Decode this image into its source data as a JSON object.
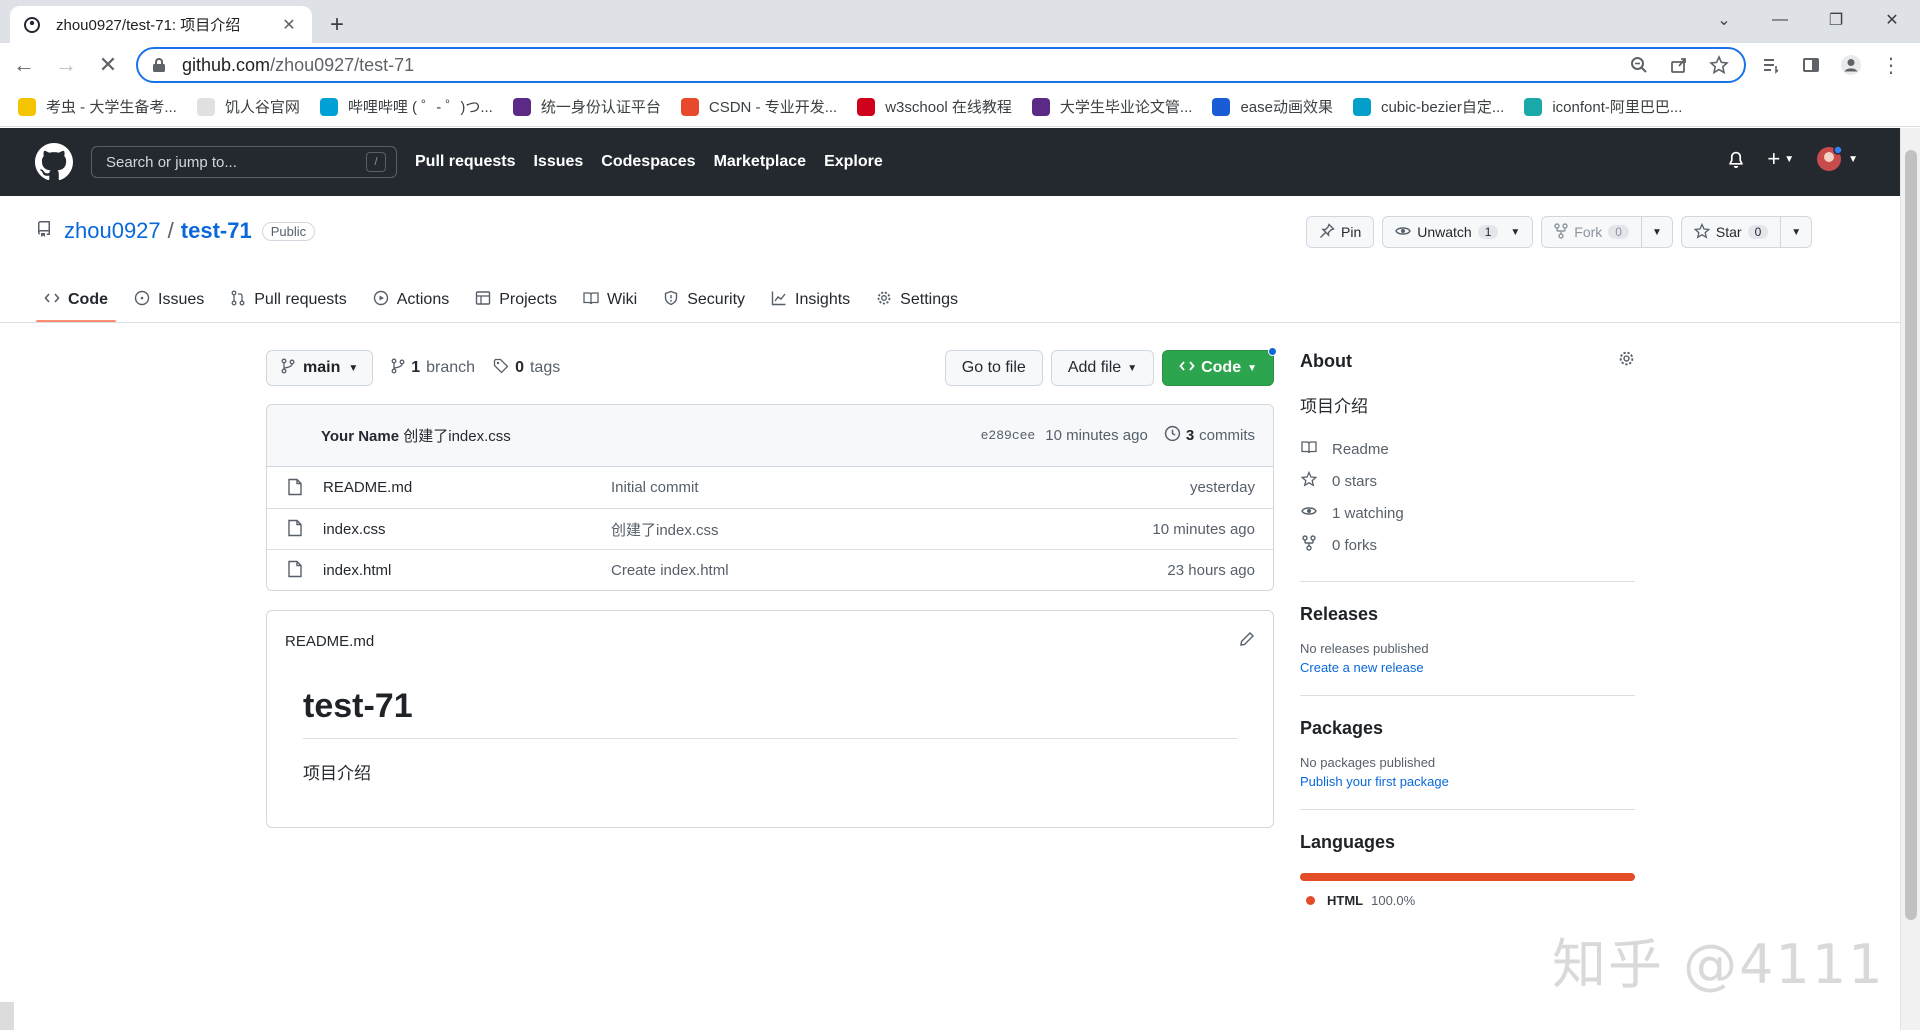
{
  "browser": {
    "tab_title": "zhou0927/test-71: 项目介绍",
    "url_host": "github.com",
    "url_path": "/zhou0927/test-71",
    "bookmarks": [
      {
        "label": "考虫 - 大学生备考...",
        "color": "#f5c400"
      },
      {
        "label": "饥人谷官网",
        "color": "#e0e0e0"
      },
      {
        "label": "哔哩哔哩 ( ゜- ゜)つ...",
        "color": "#00a1d6"
      },
      {
        "label": "统一身份认证平台",
        "color": "#5b2a86"
      },
      {
        "label": "CSDN - 专业开发...",
        "color": "#e8482c"
      },
      {
        "label": "w3school 在线教程",
        "color": "#d0021b"
      },
      {
        "label": "大学生毕业论文管...",
        "color": "#5b2a86"
      },
      {
        "label": "ease动画效果",
        "color": "#1a5bd6"
      },
      {
        "label": "cubic-bezier自定...",
        "color": "#00a0c8"
      },
      {
        "label": "iconfont-阿里巴巴...",
        "color": "#19a9a9"
      }
    ]
  },
  "gh": {
    "search_placeholder": "Search or jump to...",
    "search_hotkey": "/",
    "nav": [
      "Pull requests",
      "Issues",
      "Codespaces",
      "Marketplace",
      "Explore"
    ]
  },
  "repo": {
    "owner": "zhou0927",
    "separator": "/",
    "name": "test-71",
    "visibility": "Public",
    "pin_label": "Pin",
    "unwatch_label": "Unwatch",
    "watch_count": "1",
    "fork_label": "Fork",
    "fork_count": "0",
    "star_label": "Star",
    "star_count": "0",
    "tabs": [
      "Code",
      "Issues",
      "Pull requests",
      "Actions",
      "Projects",
      "Wiki",
      "Security",
      "Insights",
      "Settings"
    ]
  },
  "branch": {
    "current": "main",
    "branch_count": "1",
    "branch_word": "branch",
    "tag_count": "0",
    "tag_word": "tags",
    "go_to_file": "Go to file",
    "add_file": "Add file",
    "code": "Code"
  },
  "commit": {
    "author": "Your Name",
    "message": "创建了index.css",
    "sha": "e289cee",
    "time": "10 minutes ago",
    "count": "3",
    "count_word": "commits"
  },
  "files": [
    {
      "name": "README.md",
      "commit": "Initial commit",
      "time": "yesterday"
    },
    {
      "name": "index.css",
      "commit": "创建了index.css",
      "time": "10 minutes ago"
    },
    {
      "name": "index.html",
      "commit": "Create index.html",
      "time": "23 hours ago"
    }
  ],
  "readme": {
    "filename": "README.md",
    "heading": "test-71",
    "body": "项目介绍"
  },
  "about": {
    "title": "About",
    "description": "项目介绍",
    "readme": "Readme",
    "stars": "0 stars",
    "watching": "1 watching",
    "forks": "0 forks"
  },
  "releases": {
    "title": "Releases",
    "none": "No releases published",
    "link": "Create a new release"
  },
  "packages": {
    "title": "Packages",
    "none": "No packages published",
    "link": "Publish your first package"
  },
  "languages": {
    "title": "Languages",
    "items": [
      {
        "name": "HTML",
        "percent": "100.0%",
        "color": "#e34c26",
        "fraction": 1.0
      }
    ]
  },
  "watermark": "知乎 @4111"
}
